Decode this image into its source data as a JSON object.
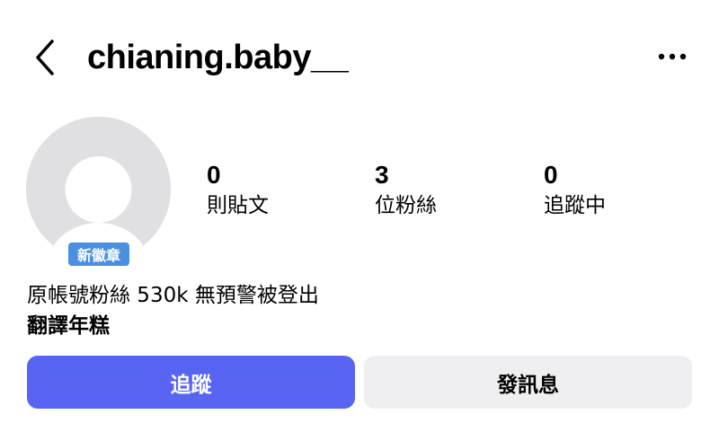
{
  "header": {
    "username": "chianing.baby__",
    "back_icon": "chevron-left-icon",
    "more_icon": "more-horizontal-icon"
  },
  "profile": {
    "avatar_icon": "default-avatar-icon",
    "badge_label": "新徽章",
    "badge_color": "#4a90e2"
  },
  "stats": [
    {
      "value": "0",
      "label": "則貼文"
    },
    {
      "value": "3",
      "label": "位粉絲"
    },
    {
      "value": "0",
      "label": "追蹤中"
    }
  ],
  "bio": {
    "text": "原帳號粉絲 530k 無預警被登出",
    "name": "翻譯年糕"
  },
  "actions": {
    "follow_label": "追蹤",
    "message_label": "發訊息",
    "follow_color": "#5865f2"
  }
}
